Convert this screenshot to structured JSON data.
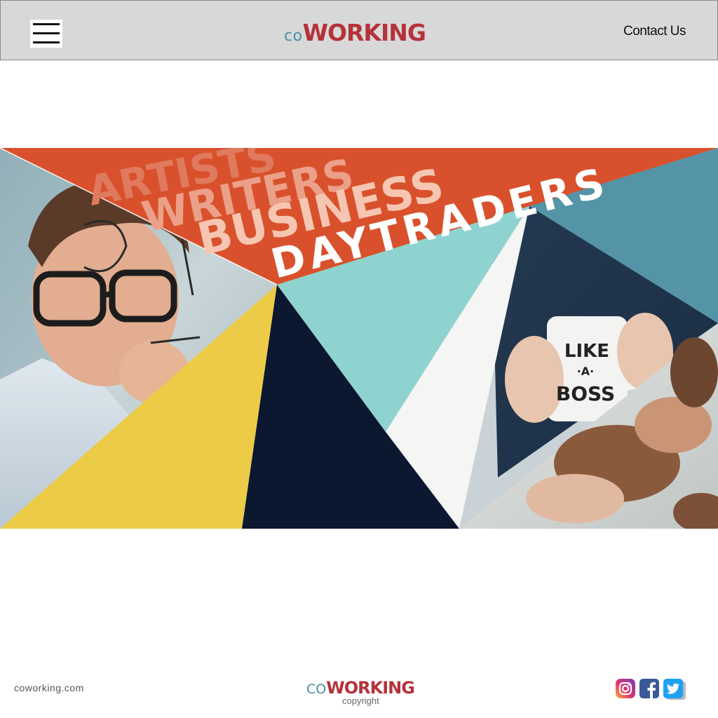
{
  "header": {
    "logo_prefix": "co",
    "logo_main": "WORKING",
    "contact_label": "Contact Us"
  },
  "hero": {
    "words": [
      "ARTISTS",
      "WRITERS",
      "BUSINESS",
      "DAYTRADERS"
    ],
    "mug_text": [
      "LIKE",
      "·A·",
      "BOSS"
    ]
  },
  "footer": {
    "url": "coworking.com",
    "logo_prefix": "CO",
    "logo_main": "WORKING",
    "copyright": "copyright",
    "social": [
      "instagram-icon",
      "facebook-icon",
      "twitter-icon"
    ]
  },
  "colors": {
    "header_bg": "#d8d8d8",
    "brand_red": "#b5323a",
    "brand_teal": "#4a8fa3",
    "orange": "#d9512c",
    "yellow": "#eccb47",
    "navy": "#0c1730",
    "mint": "#8ed3cf",
    "steel_teal": "#5494a6"
  }
}
